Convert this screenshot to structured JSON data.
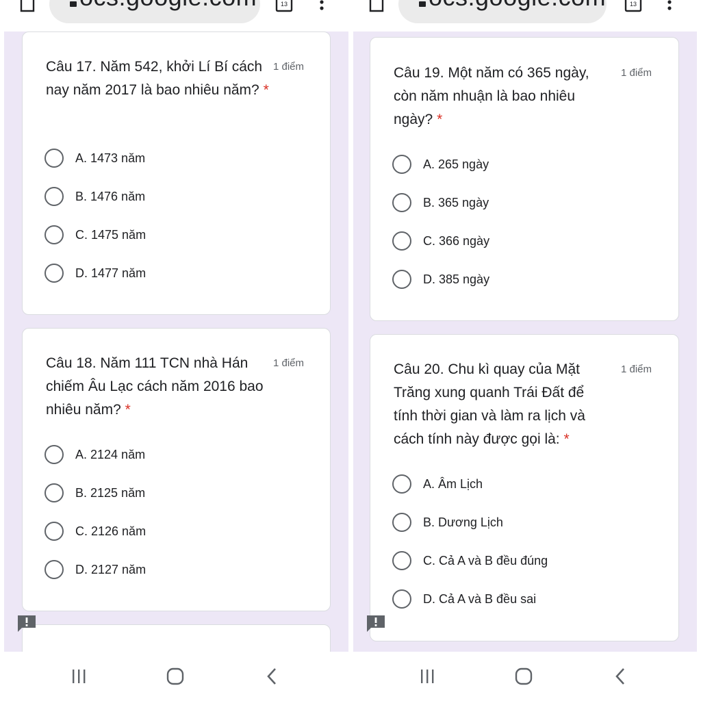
{
  "left": {
    "url": "ocs.google.com",
    "questions": [
      {
        "title": "Câu 17. Năm 542, khởi Lí Bí cách nay năm 2017 là bao nhiêu năm?",
        "required_mark": "*",
        "points": "1 điểm",
        "options": [
          "A. 1473 năm",
          "B. 1476 năm",
          "C. 1475 năm",
          "D. 1477 năm"
        ]
      },
      {
        "title": "Câu 18. Năm 111 TCN nhà Hán chiếm Âu Lạc cách năm 2016 bao nhiêu năm?",
        "required_mark": "*",
        "points": "1 điểm",
        "options": [
          "A. 2124 năm",
          "B. 2125 năm",
          "C. 2126 năm",
          "D. 2127 năm"
        ]
      }
    ]
  },
  "right": {
    "url": "ocs.google.com",
    "questions": [
      {
        "title": "Câu 19. Một năm có 365 ngày, còn năm nhuận là bao nhiêu ngày?",
        "required_mark": "*",
        "points": "1 điểm",
        "options": [
          "A. 265 ngày",
          "B. 365 ngày",
          "C. 366 ngày",
          "D. 385 ngày"
        ]
      },
      {
        "title": "Câu 20. Chu kì quay của Mặt Trăng xung quanh Trái Đất để tính thời gian và làm ra lịch và cách tính này được gọi là:",
        "required_mark": "*",
        "points": "1 điểm",
        "options": [
          "A. Âm Lịch",
          "B. Dương Lịch",
          "C. Cả A và B đều đúng",
          "D. Cả A và B đều sai"
        ]
      }
    ]
  },
  "icons": {
    "home": "home-icon",
    "lock": "lock-icon",
    "tabs": "tabs-icon",
    "menu": "more-vert-icon",
    "feedback": "report-problem-icon",
    "recents": "recent-apps-icon",
    "nav_home": "nav-home-icon",
    "back": "back-icon"
  },
  "colors": {
    "form_background": "#ede7f6",
    "card_background": "#ffffff",
    "required": "#d93025",
    "radio_border": "#5f6368",
    "feedback_icon": "#5f6368"
  }
}
